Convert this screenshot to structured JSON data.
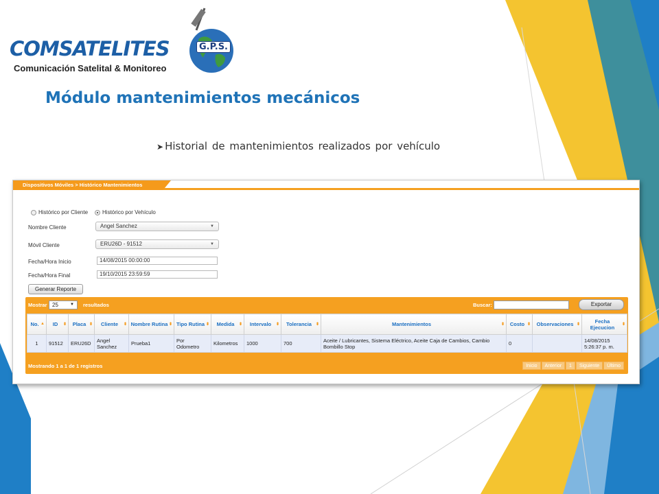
{
  "logo": {
    "wordmark": "COMSATELITES",
    "badge": "G.P.S.",
    "tagline": "Comunicación Satelital & Monitoreo"
  },
  "slide": {
    "title": "Módulo mantenimientos mecánicos",
    "bullet": "Historial de mantenimientos realizados por vehículo"
  },
  "colors": {
    "title_blue": "#1f73b7",
    "accent_orange": "#f5a020",
    "deco_yellow": "#f4c430",
    "deco_blue": "#1f7fc6",
    "deco_teal": "#3e8f9c"
  },
  "app": {
    "breadcrumb": "Dispositivos Móviles > Histórico Mantenimientos",
    "radios": [
      {
        "label": "Histórico por Cliente",
        "selected": false
      },
      {
        "label": "Histórico por Vehículo",
        "selected": true
      }
    ],
    "form": {
      "cliente_label": "Nombre Cliente",
      "cliente_value": "Angel Sanchez",
      "movil_label": "Móvil Cliente",
      "movil_value": "ERU26D - 91512",
      "inicio_label": "Fecha/Hora Inicio",
      "inicio_value": "14/08/2015 00:00:00",
      "final_label": "Fecha/Hora Final",
      "final_value": "19/10/2015 23:59:59",
      "generate_label": "Generar Reporte"
    },
    "grid": {
      "show_label": "Mostrar",
      "page_size": "25",
      "results_label": "resultados",
      "search_label": "Buscar:",
      "export_label": "Exportar",
      "columns": [
        "No.",
        "ID",
        "Placa",
        "Cliente",
        "Nombre Rutina",
        "Tipo Rutina",
        "Medida",
        "Intervalo",
        "Tolerancia",
        "Mantenimientos",
        "Costo",
        "Observaciones",
        "Fecha Ejecucion"
      ],
      "rows": [
        {
          "no": "1",
          "id": "91512",
          "placa": "ERU26D",
          "cliente": "Angel Sanchez",
          "nombre_rutina": "Prueba1",
          "tipo_rutina": "Por Odometro",
          "medida": "Kilometros",
          "intervalo": "1000",
          "tolerancia": "700",
          "mantenimientos": "Aceite / Lubricantes, Sistema Eléctrico, Aceite Caja de Cambios, Cambio Bombillo Stop",
          "costo": "0",
          "observaciones": "",
          "fecha": "14/08/2015 5:26:37 p. m."
        }
      ],
      "footer_info": "Mostrando 1 a 1 de 1 registros",
      "pager": [
        "Inicio",
        "Anterior",
        "1",
        "Siguiente",
        "Último"
      ]
    }
  }
}
